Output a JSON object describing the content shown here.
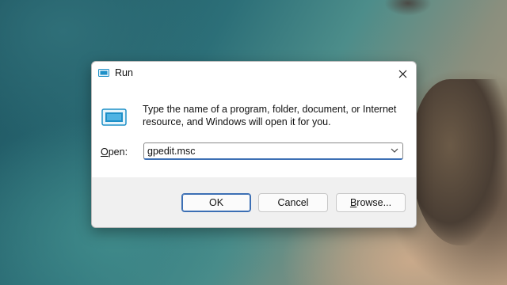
{
  "dialog": {
    "title": "Run",
    "description": "Type the name of a program, folder, document, or Internet resource, and Windows will open it for you.",
    "open_label_first": "O",
    "open_label_rest": "pen:",
    "open_value": "gpedit.msc",
    "buttons": {
      "ok": "OK",
      "cancel": "Cancel",
      "browse_first": "B",
      "browse_rest": "rowse..."
    }
  },
  "icons": {
    "title": "run-app-icon",
    "large": "run-app-icon",
    "close": "close-icon",
    "dropdown": "chevron-down-icon"
  },
  "colors": {
    "accent": "#3c6fb4",
    "icon_blue": "#1e90c8"
  }
}
